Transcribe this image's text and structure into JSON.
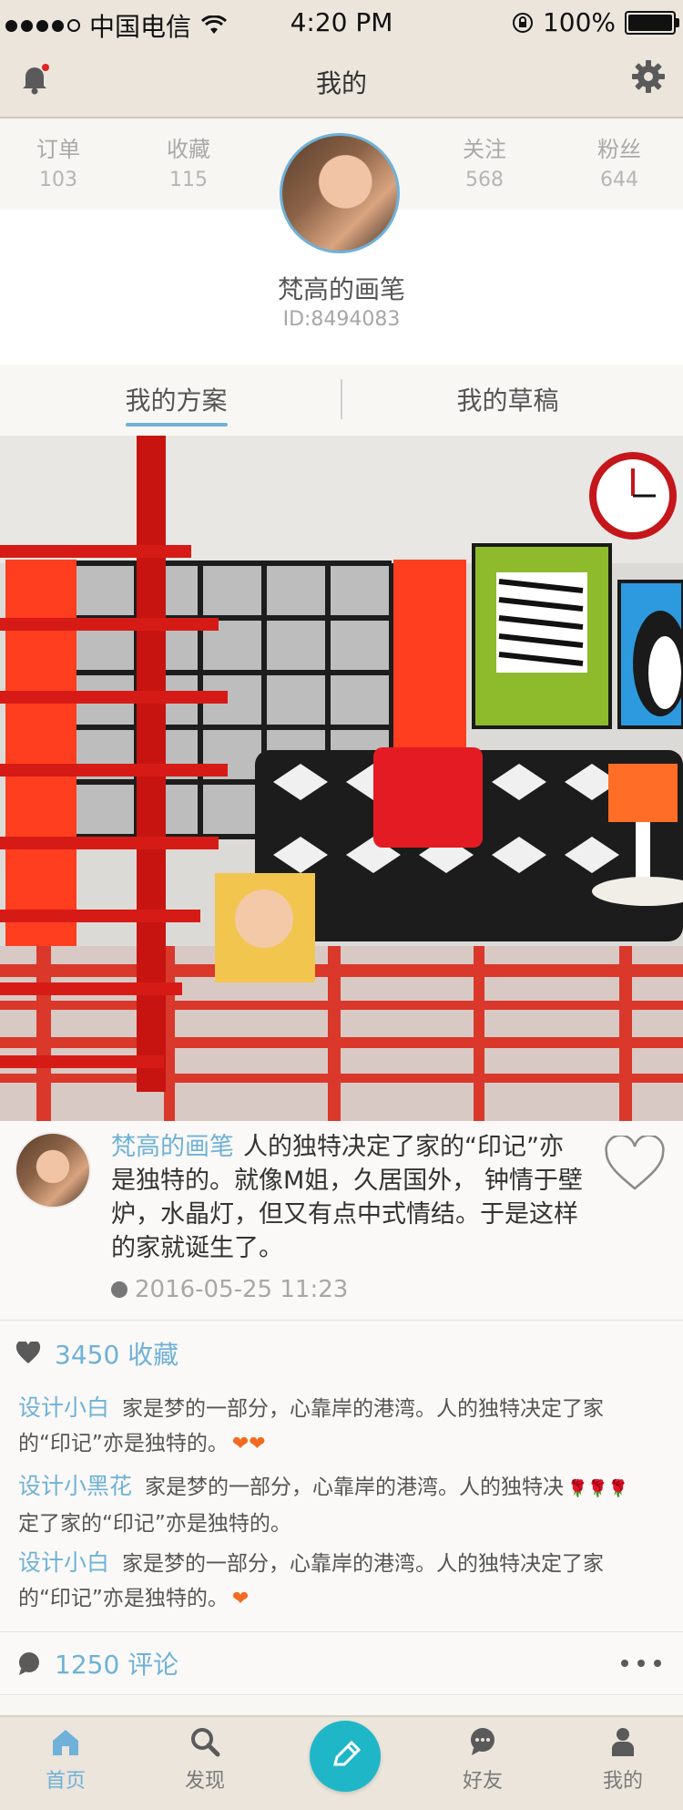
{
  "status_bar": {
    "carrier": "中国电信",
    "time": "4:20 PM",
    "battery_text": "100%"
  },
  "nav": {
    "title": "我的"
  },
  "profile": {
    "stats": [
      {
        "label": "订单",
        "value": "103"
      },
      {
        "label": "收藏",
        "value": "115"
      },
      {
        "label": "关注",
        "value": "568"
      },
      {
        "label": "粉丝",
        "value": "644"
      }
    ],
    "username": "梵高的画笔",
    "user_id": "ID:8494083"
  },
  "tabs": {
    "active": "我的方案",
    "other": "我的草稿"
  },
  "post": {
    "author": "梵高的画笔",
    "text": "人的独特决定了家的“印记”亦是独特的。就像M姐，久居国外， 钟情于壁炉，水晶灯，但又有点中式情结。于是这样的家就诞生了。",
    "timestamp": "2016-05-25  11:23"
  },
  "favorites": {
    "text": "3450 收藏"
  },
  "comments": [
    {
      "user": "设计小白",
      "text": "家是梦的一部分，心靠岸的港湾。人的独特决定了家的“印记”亦是独特的。",
      "emoji": "❤❤"
    },
    {
      "user": "设计小黑花",
      "text": "家是梦的一部分，心靠岸的港湾。人的独特决",
      "emoji": "🌹🌹🌹",
      "text2": "定了家的“印记”亦是独特的。"
    },
    {
      "user": "设计小白",
      "text": "家是梦的一部分，心靠岸的港湾。人的独特决定了家的“印记”亦是独特的。",
      "emoji": "❤"
    }
  ],
  "comment_summary": {
    "text": "1250 评论"
  },
  "tabbar": {
    "home": "首页",
    "discover": "发现",
    "friends": "好友",
    "me": "我的"
  },
  "colors": {
    "accent": "#6fb1d8",
    "compose": "#1fb7c7",
    "bar": "#ebe5dc"
  }
}
